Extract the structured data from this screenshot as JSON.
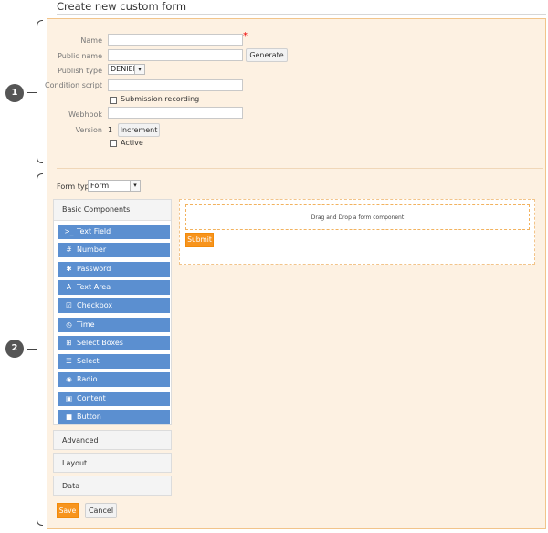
{
  "page": {
    "title": "Create new custom form"
  },
  "callouts": [
    "1",
    "2"
  ],
  "settings": {
    "name_label": "Name",
    "name_value": "",
    "required_mark": "*",
    "public_name_label": "Public name",
    "public_name_value": "",
    "generate_label": "Generate",
    "publish_type_label": "Publish type",
    "publish_type_value": "DENIED",
    "condition_script_label": "Condition script",
    "condition_script_value": "",
    "submission_recording_label": "Submission recording",
    "submission_recording_checked": false,
    "webhook_label": "Webhook",
    "webhook_value": "",
    "version_label": "Version",
    "version_value": "1",
    "increment_label": "Increment",
    "active_label": "Active",
    "active_checked": false
  },
  "builder": {
    "form_type_label": "Form type",
    "form_type_value": "Form",
    "basic_components_label": "Basic Components",
    "components": [
      {
        "label": "Text Field",
        "icon": "terminal-icon",
        "glyph": ">_"
      },
      {
        "label": "Number",
        "icon": "hash-icon",
        "glyph": "#"
      },
      {
        "label": "Password",
        "icon": "asterisk-icon",
        "glyph": "✱"
      },
      {
        "label": "Text Area",
        "icon": "font-icon",
        "glyph": "A"
      },
      {
        "label": "Checkbox",
        "icon": "check-square-icon",
        "glyph": "☑"
      },
      {
        "label": "Time",
        "icon": "clock-icon",
        "glyph": "◷"
      },
      {
        "label": "Select Boxes",
        "icon": "plus-square-icon",
        "glyph": "⊞"
      },
      {
        "label": "Select",
        "icon": "list-icon",
        "glyph": "☰"
      },
      {
        "label": "Radio",
        "icon": "radio-icon",
        "glyph": "◉"
      },
      {
        "label": "Content",
        "icon": "html5-icon",
        "glyph": "▣"
      },
      {
        "label": "Button",
        "icon": "stop-icon",
        "glyph": "■"
      }
    ],
    "groups": [
      "Advanced",
      "Layout",
      "Data"
    ],
    "drop_hint": "Drag and Drop a form component",
    "submit_label": "Submit"
  },
  "footer": {
    "save_label": "Save",
    "cancel_label": "Cancel"
  },
  "colors": {
    "accent": "#f7941d",
    "component": "#5b8fd0",
    "panel": "#fdf1e2"
  }
}
